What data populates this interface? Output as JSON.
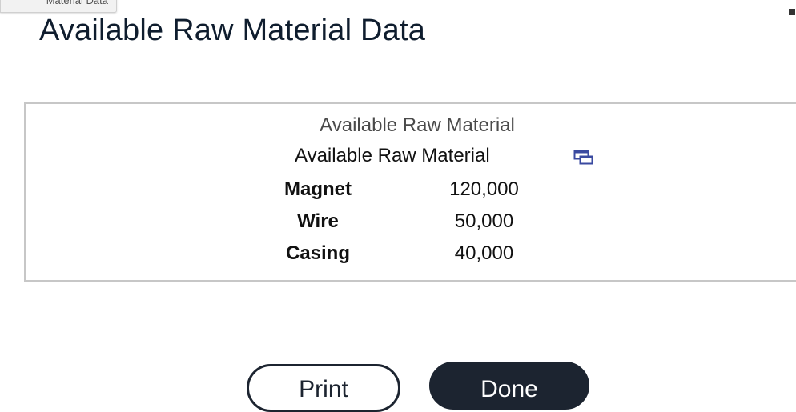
{
  "window": {
    "tab_label": "Material Data"
  },
  "page": {
    "title": "Available Raw Material Data"
  },
  "table": {
    "caption": "Available Raw Material",
    "header": "Available Raw Material",
    "popout_icon": "popout-window-icon",
    "rows": [
      {
        "label": "Magnet",
        "value": "120,000"
      },
      {
        "label": "Wire",
        "value": "50,000"
      },
      {
        "label": "Casing",
        "value": "40,000"
      }
    ]
  },
  "buttons": {
    "print_label": "Print",
    "done_label": "Done"
  },
  "colors": {
    "title_text": "#0f1d2e",
    "panel_border": "#c7c7c7",
    "primary_button": "#1c2430",
    "icon_accent": "#3a4aa0"
  }
}
